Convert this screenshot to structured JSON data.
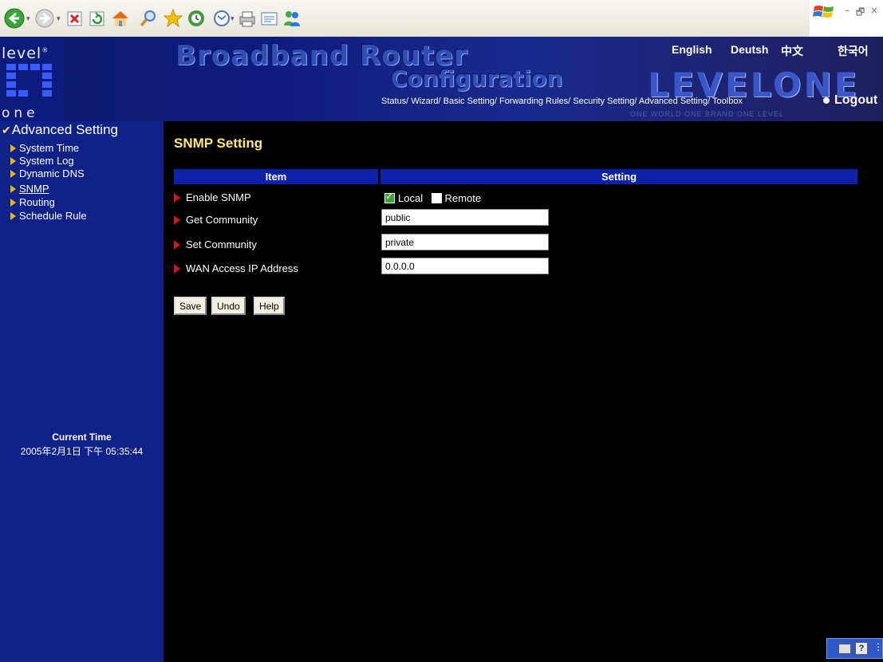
{
  "toolbar": {
    "buttons": [
      "back-icon",
      "forward-icon",
      "stop-icon",
      "refresh-icon",
      "home-icon",
      "search-icon",
      "favorites-icon",
      "history-icon",
      "mail-icon",
      "print-icon",
      "edit-icon",
      "messenger-icon"
    ],
    "window_controls": {
      "minimize": "–",
      "restore": "🗗",
      "close": "×"
    }
  },
  "banner": {
    "logo_top": "level",
    "logo_reg": "®",
    "logo_bottom": "one",
    "title_line1": "Broadband Router",
    "title_line2": "Configuration",
    "brand": "LEVELONE",
    "tagline": "ONE WORLD  ONE BRAND  ONE LEVEL",
    "languages": [
      "English",
      "Deutsh",
      "中文",
      "한국어"
    ],
    "nav": [
      "Status/",
      "Wizard/",
      "Basic Setting/",
      "Forwarding Rules/",
      "Security Setting/",
      "Advanced Setting/",
      "Toolbox"
    ],
    "logout": "Logout"
  },
  "sidebar": {
    "title": "Advanced Setting",
    "items": [
      "System Time",
      "System Log",
      "Dynamic DNS",
      "SNMP",
      "Routing",
      "Schedule Rule"
    ],
    "active": "SNMP",
    "current_time_label": "Current Time",
    "current_time_value": "2005年2月1日 下午 05:35:44"
  },
  "main": {
    "title": "SNMP Setting",
    "headers": {
      "item": "Item",
      "setting": "Setting"
    },
    "rows": {
      "enable_snmp": {
        "label": "Enable SNMP",
        "local_label": "Local",
        "local_checked": true,
        "remote_label": "Remote",
        "remote_checked": false
      },
      "get_community": {
        "label": "Get Community",
        "value": "public"
      },
      "set_community": {
        "label": "Set Community",
        "value": "private"
      },
      "wan_access": {
        "label": "WAN Access IP Address",
        "value": "0.0.0.0"
      }
    },
    "buttons": {
      "save": "Save",
      "undo": "Undo",
      "help": "Help"
    }
  },
  "colors": {
    "sidebar_bg": "#10228a",
    "table_header_bg": "#0d22a8",
    "page_title": "#ffe978",
    "content_bg": "#000000",
    "row_arrow": "#d01818"
  }
}
